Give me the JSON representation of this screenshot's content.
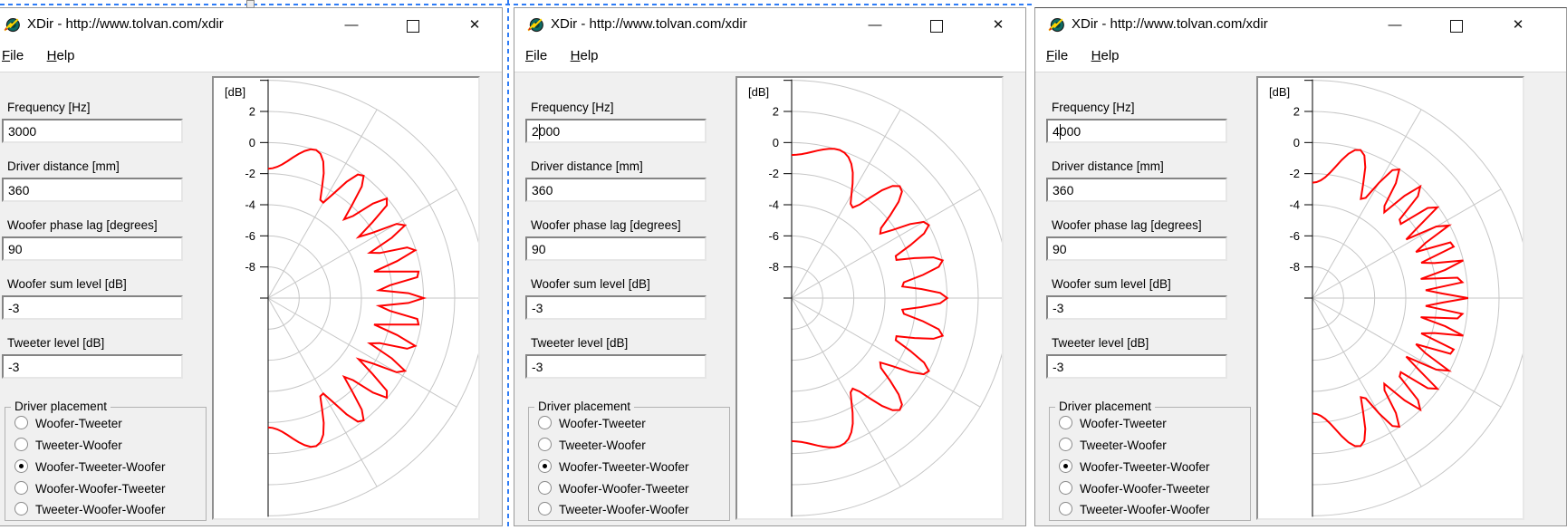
{
  "selection_overlay": {
    "color": "#2e7cf6"
  },
  "windows": [
    {
      "title": "XDir - http://www.tolvan.com/xdir",
      "menu": {
        "file": "File",
        "help": "Help"
      },
      "controls": {
        "minimize": "—",
        "close": "✕"
      },
      "form": {
        "fields": [
          {
            "label": "Frequency [Hz]",
            "value": "3000"
          },
          {
            "label": "Driver distance [mm]",
            "value": "360"
          },
          {
            "label": "Woofer phase lag [degrees]",
            "value": "90"
          },
          {
            "label": "Woofer sum level [dB]",
            "value": "-3"
          },
          {
            "label": "Tweeter level [dB]",
            "value": "-3"
          }
        ],
        "driver_placement": {
          "label": "Driver placement",
          "options": [
            "Woofer-Tweeter",
            "Tweeter-Woofer",
            "Woofer-Tweeter-Woofer",
            "Woofer-Woofer-Tweeter",
            "Tweeter-Woofer-Woofer"
          ],
          "selected_index": 2,
          "selected": "Woofer-Tweeter-Woofer"
        }
      }
    },
    {
      "title": "XDir - http://www.tolvan.com/xdir",
      "menu": {
        "file": "File",
        "help": "Help"
      },
      "controls": {
        "minimize": "—",
        "close": "✕"
      },
      "form": {
        "fields": [
          {
            "label": "Frequency [Hz]",
            "value": "2000",
            "caret_after_chars": 1
          },
          {
            "label": "Driver distance [mm]",
            "value": "360"
          },
          {
            "label": "Woofer phase lag [degrees]",
            "value": "90"
          },
          {
            "label": "Woofer sum level [dB]",
            "value": "-3"
          },
          {
            "label": "Tweeter level [dB]",
            "value": "-3"
          }
        ],
        "driver_placement": {
          "label": "Driver placement",
          "options": [
            "Woofer-Tweeter",
            "Tweeter-Woofer",
            "Woofer-Tweeter-Woofer",
            "Woofer-Woofer-Tweeter",
            "Tweeter-Woofer-Woofer"
          ],
          "selected_index": 2,
          "selected": "Woofer-Tweeter-Woofer"
        }
      }
    },
    {
      "title": "XDir - http://www.tolvan.com/xdir",
      "menu": {
        "file": "File",
        "help": "Help"
      },
      "controls": {
        "minimize": "—",
        "close": "✕"
      },
      "form": {
        "fields": [
          {
            "label": "Frequency [Hz]",
            "value": "4000",
            "caret_after_chars": 1
          },
          {
            "label": "Driver distance [mm]",
            "value": "360"
          },
          {
            "label": "Woofer phase lag [degrees]",
            "value": "90"
          },
          {
            "label": "Woofer sum level [dB]",
            "value": "-3"
          },
          {
            "label": "Tweeter level [dB]",
            "value": "-3"
          }
        ],
        "driver_placement": {
          "label": "Driver placement",
          "options": [
            "Woofer-Tweeter",
            "Tweeter-Woofer",
            "Woofer-Tweeter-Woofer",
            "Woofer-Woofer-Tweeter",
            "Tweeter-Woofer-Woofer"
          ],
          "selected_index": 2,
          "selected": "Woofer-Tweeter-Woofer"
        }
      }
    }
  ],
  "chart_data": [
    {
      "type": "line",
      "subtype": "polar-directivity",
      "title": "[dB]",
      "radial_axis_label": "[dB]",
      "radial_ticks": [
        2,
        0,
        -2,
        -4,
        -6,
        -8
      ],
      "radial_range_db": [
        -10,
        4
      ],
      "ring_step_db": 2,
      "angle_range_deg": [
        -90,
        90
      ],
      "angle_gridline_step_deg": 30,
      "grid": true,
      "series": [
        {
          "name": "directivity-response",
          "color": "#ff0000",
          "sample_step_deg": 2,
          "model": {
            "placement": "Woofer-Tweeter-Woofer",
            "frequency_hz": 3000,
            "driver_distance_mm": 360,
            "woofer_phase_lag_deg": 90,
            "woofer_sum_level_db": -3,
            "tweeter_level_db": -3,
            "on_axis_level_db": 0,
            "null_level_db": -3
          }
        }
      ]
    },
    {
      "type": "line",
      "subtype": "polar-directivity",
      "title": "[dB]",
      "radial_axis_label": "[dB]",
      "radial_ticks": [
        2,
        0,
        -2,
        -4,
        -6,
        -8
      ],
      "radial_range_db": [
        -10,
        4
      ],
      "ring_step_db": 2,
      "angle_range_deg": [
        -90,
        90
      ],
      "angle_gridline_step_deg": 30,
      "grid": true,
      "series": [
        {
          "name": "directivity-response",
          "color": "#ff0000",
          "sample_step_deg": 2,
          "model": {
            "placement": "Woofer-Tweeter-Woofer",
            "frequency_hz": 2000,
            "driver_distance_mm": 360,
            "woofer_phase_lag_deg": 90,
            "woofer_sum_level_db": -3,
            "tweeter_level_db": -3,
            "on_axis_level_db": 0,
            "null_level_db": -3
          }
        }
      ]
    },
    {
      "type": "line",
      "subtype": "polar-directivity",
      "title": "[dB]",
      "radial_axis_label": "[dB]",
      "radial_ticks": [
        2,
        0,
        -2,
        -4,
        -6,
        -8
      ],
      "radial_range_db": [
        -10,
        4
      ],
      "ring_step_db": 2,
      "angle_range_deg": [
        -90,
        90
      ],
      "angle_gridline_step_deg": 30,
      "grid": true,
      "series": [
        {
          "name": "directivity-response",
          "color": "#ff0000",
          "sample_step_deg": 2,
          "model": {
            "placement": "Woofer-Tweeter-Woofer",
            "frequency_hz": 4000,
            "driver_distance_mm": 360,
            "woofer_phase_lag_deg": 90,
            "woofer_sum_level_db": -3,
            "tweeter_level_db": -3,
            "on_axis_level_db": 0,
            "null_level_db": -3
          }
        }
      ]
    }
  ]
}
